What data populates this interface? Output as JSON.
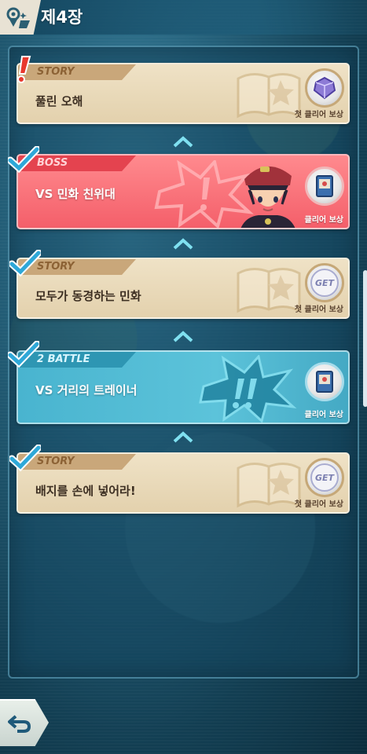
{
  "header": {
    "chapter_title": "제4장",
    "icon": "map-pin-icon"
  },
  "stages": [
    {
      "type_label": "STORY",
      "name": "풀린 오해",
      "status": "new",
      "status_icon": "exclamation-icon",
      "reward_label": "첫 클리어 보상",
      "reward_icon": "crystal-icon"
    },
    {
      "type_label": "BOSS",
      "name": "VS 민화 친위대",
      "status": "cleared",
      "status_icon": "check-icon",
      "reward_label": "클리어 보상",
      "reward_icon": "card-item-icon"
    },
    {
      "type_label": "STORY",
      "name": "모두가 동경하는 민화",
      "status": "cleared",
      "status_icon": "check-icon",
      "reward_label": "첫 클리어 보상",
      "reward_badge": "GET"
    },
    {
      "type_label": "2 BATTLE",
      "name": "VS 거리의 트레이너",
      "status": "cleared",
      "status_icon": "check-icon",
      "reward_label": "클리어 보상",
      "reward_icon": "card-item-icon"
    },
    {
      "type_label": "STORY",
      "name": "배지를 손에 넣어라!",
      "status": "cleared",
      "status_icon": "check-icon",
      "reward_label": "첫 클리어 보상",
      "reward_badge": "GET"
    }
  ],
  "back_button_icon": "back-arrow-icon",
  "colors": {
    "story": "#e3d1ad",
    "boss": "#f45f6a",
    "battle": "#49b4cf",
    "check": "#2ea8d8"
  }
}
